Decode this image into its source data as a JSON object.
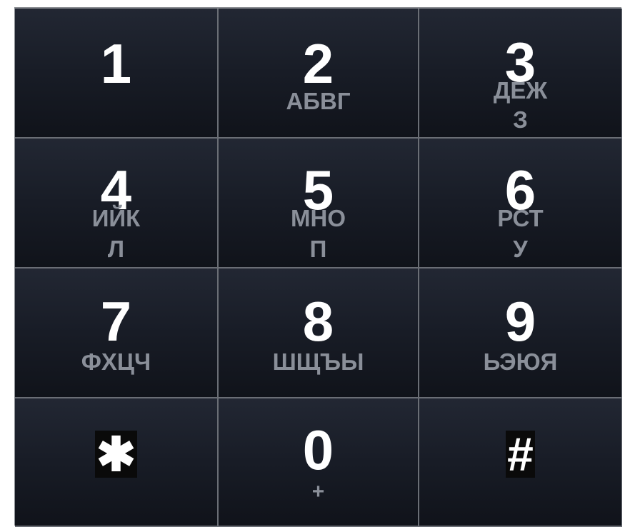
{
  "keypad": {
    "keys": [
      {
        "digit": "1",
        "letters": ""
      },
      {
        "digit": "2",
        "letters": "АБВГ"
      },
      {
        "digit": "3",
        "letters_line1": "ДЕЖ",
        "letters_line2": "З"
      },
      {
        "digit": "4",
        "letters_line1": "ИЙК",
        "letters_line2": "Л"
      },
      {
        "digit": "5",
        "letters_line1": "МНО",
        "letters_line2": "П"
      },
      {
        "digit": "6",
        "letters_line1": "РСТ",
        "letters_line2": "У"
      },
      {
        "digit": "7",
        "letters": "ФХЦЧ"
      },
      {
        "digit": "8",
        "letters": "ШЩЪЫ"
      },
      {
        "digit": "9",
        "letters": "ЬЭЮЯ"
      },
      {
        "symbol": "✱"
      },
      {
        "digit": "0",
        "letters": "+"
      },
      {
        "symbol": "#"
      }
    ]
  }
}
